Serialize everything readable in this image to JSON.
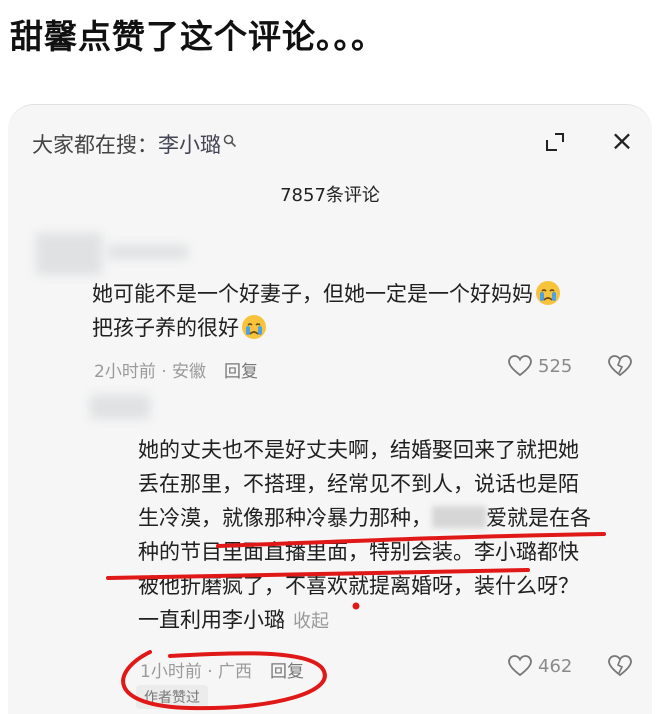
{
  "headline": "甜馨点赞了这个评论。。。",
  "panel": {
    "search_label": "大家都在搜：",
    "search_term": "李小璐",
    "search_icon": "search-icon",
    "expand_icon": "expand-icon",
    "close_icon": "close-icon",
    "close_glyph": "×",
    "comment_count": "7857条评论"
  },
  "comments": [
    {
      "line1": "她可能不是一个好妻子，但她一定是一个好妈妈",
      "line2": "把孩子养的很好",
      "emoji": "crying-face-icon",
      "time": "2小时前 · 安徽",
      "reply": "回复",
      "likes": "525"
    },
    {
      "line1": "她的丈夫也不是好丈夫啊，结婚娶回来了就把她",
      "line2": "丢在那里，不搭理，经常见不到人，说话也是陌",
      "line3a": "生冷漠，就像那种冷暴力那种，",
      "line3b": "爱就是在各",
      "line4": "种的节目里面直播里面，特别会装。李小璐都快",
      "line5": "被他折磨疯了，不喜欢就提离婚呀，装什么呀？",
      "line6": "一直利用李小璐",
      "collapse": "收起",
      "time": "1小时前 · 广西",
      "reply": "回复",
      "likes": "462",
      "author_liked": "作者赞过"
    }
  ],
  "colors": {
    "annotation_red": "#e01818",
    "background": "#f6f6f6"
  }
}
